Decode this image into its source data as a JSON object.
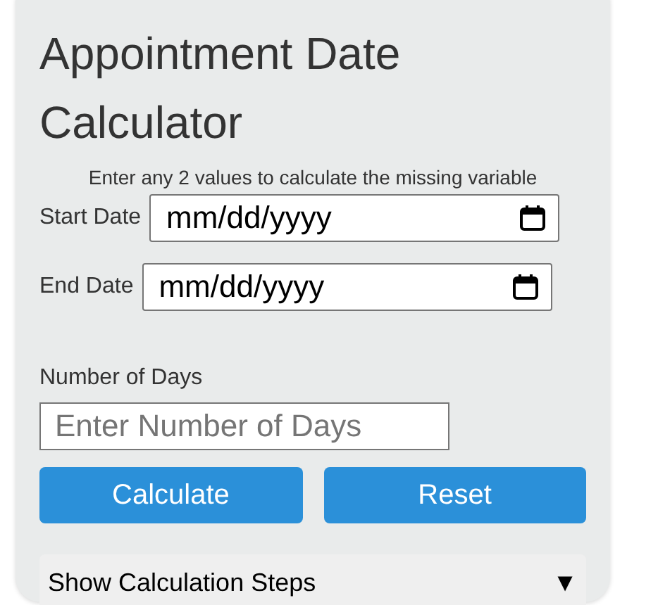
{
  "title": "Appointment Date Calculator",
  "instructions": "Enter any 2 values to calculate the missing variable",
  "date_fields": [
    {
      "label": "Start Date",
      "placeholder": "mm/dd/yyyy"
    },
    {
      "label": "End Date",
      "placeholder": "mm/dd/yyyy"
    }
  ],
  "days_field": {
    "label": "Number of Days",
    "placeholder": "Enter Number of Days"
  },
  "buttons": [
    "Calculate",
    "Reset"
  ],
  "steps_toggle": {
    "label": "Show Calculation Steps",
    "arrow": "▼",
    "expanded": false
  }
}
